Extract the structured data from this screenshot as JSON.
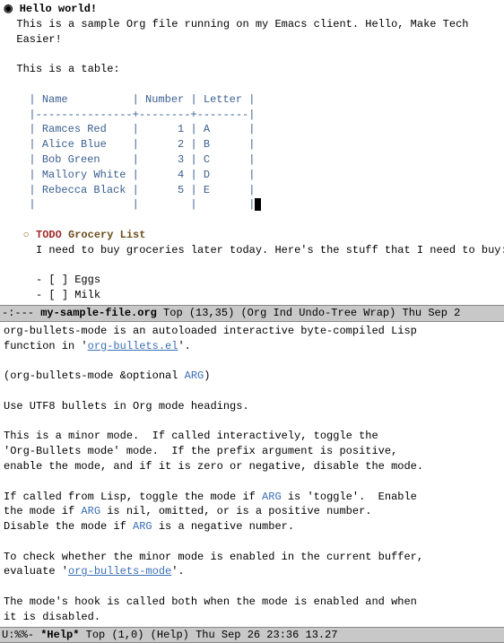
{
  "org": {
    "bullet1": "◉",
    "heading1": "Hello world!",
    "body1_l1": "This is a sample Org file running on my Emacs client. Hello, Make Tech",
    "body1_l2": "Easier!",
    "body2": "This is a table:",
    "table": {
      "h_name": "Name",
      "h_number": "Number",
      "h_letter": "Letter",
      "sep": "|---------------+--------+--------|",
      "rows": [
        {
          "name": "Ramces Red",
          "num": "1",
          "letter": "A"
        },
        {
          "name": "Alice Blue",
          "num": "2",
          "letter": "B"
        },
        {
          "name": "Bob Green",
          "num": "3",
          "letter": "C"
        },
        {
          "name": "Mallory White",
          "num": "4",
          "letter": "D"
        },
        {
          "name": "Rebecca Black",
          "num": "5",
          "letter": "E"
        }
      ],
      "empty_row": "|               |        |        |"
    },
    "sub_bullet": "○",
    "todo": "TODO",
    "sub_heading": "Grocery List",
    "sub_body": "I need to buy groceries later today. Here's the stuff that I need to buy:",
    "checkbox_open": "[ ]",
    "items": [
      "Eggs",
      "Milk"
    ]
  },
  "modeline1": {
    "left": "-:---",
    "bufname": "my-sample-file.org",
    "pos": "Top",
    "linecol": "(13,35)",
    "modes": "(Org Ind Undo-Tree Wrap)",
    "date": "Thu Sep 2"
  },
  "help": {
    "l1a": "org-bullets-mode is an autoloaded interactive byte-compiled Lisp",
    "l1b_pre": "function in '",
    "l1b_link": "org-bullets.el",
    "l1b_post": "'.",
    "sig_pre": "(org-bullets-mode &optional ",
    "sig_arg": "ARG",
    "sig_post": ")",
    "l3": "Use UTF8 bullets in Org mode headings.",
    "l4a": "This is a minor mode.  If called interactively, toggle the",
    "l4b": "'Org-Bullets mode' mode.  If the prefix argument is positive,",
    "l4c": "enable the mode, and if it is zero or negative, disable the mode.",
    "l5a_pre": "If called from Lisp, toggle the mode if ",
    "l5a_arg": "ARG",
    "l5a_post": " is 'toggle'.  Enable",
    "l5b_pre": "the mode if ",
    "l5b_arg": "ARG",
    "l5b_post": " is nil, omitted, or is a positive number.",
    "l5c_pre": "Disable the mode if ",
    "l5c_arg": "ARG",
    "l5c_post": " is a negative number.",
    "l6a": "To check whether the minor mode is enabled in the current buffer,",
    "l6b_pre": "evaluate '",
    "l6b_link": "org-bullets-mode",
    "l6b_post": "'.",
    "l7a": "The mode's hook is called both when the mode is enabled and when",
    "l7b": "it is disabled."
  },
  "modeline2": {
    "left": "U:%%-",
    "bufname": "*Help*",
    "pos": "Top",
    "linecol": "(1,0)",
    "modes": "(Help)",
    "date": "Thu Sep 26 23:36 13.27"
  }
}
